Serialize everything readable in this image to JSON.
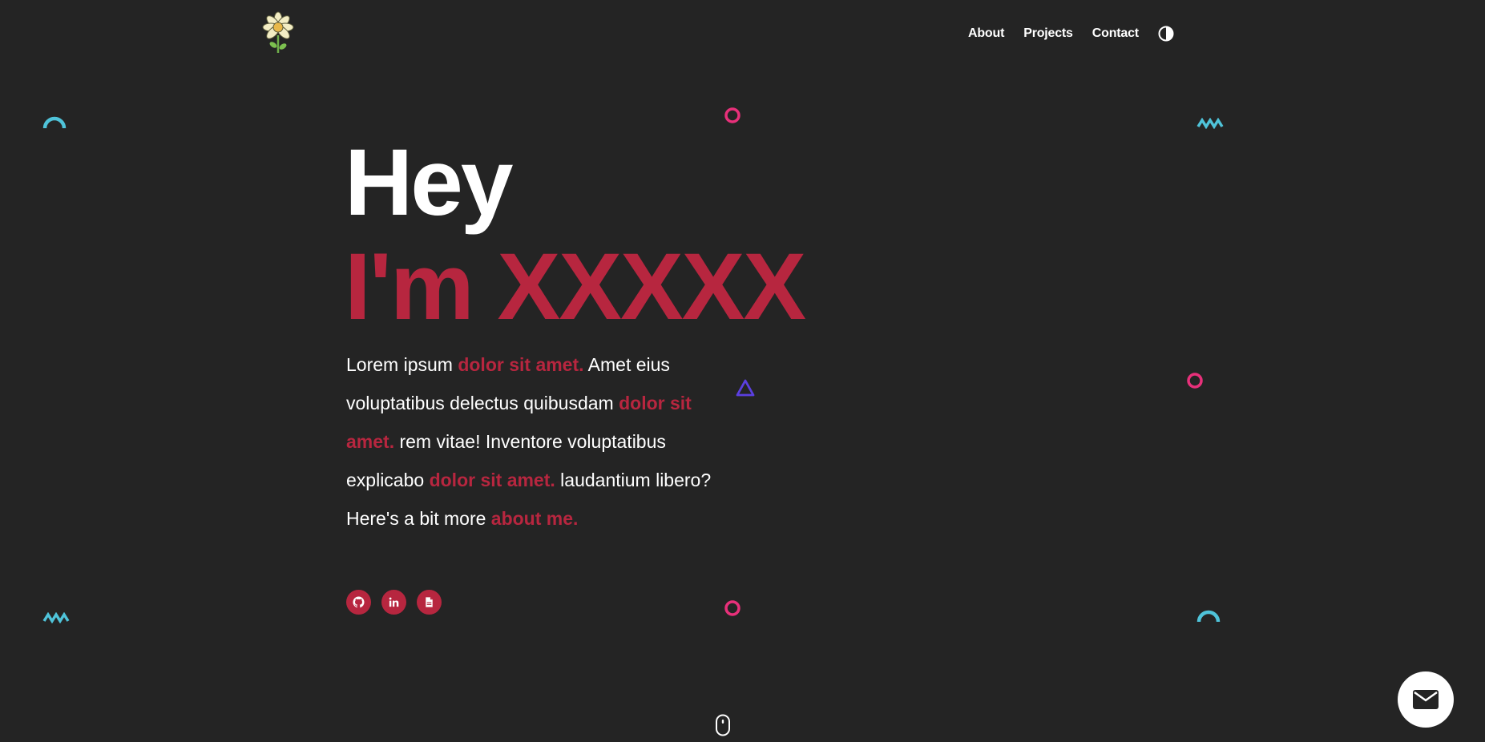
{
  "nav": {
    "items": [
      {
        "label": "About"
      },
      {
        "label": "Projects"
      },
      {
        "label": "Contact"
      }
    ]
  },
  "hero": {
    "greeting": "Hey",
    "name": "I'm XXXXX",
    "description": {
      "p1": "Lorem ipsum ",
      "h1": "dolor sit amet.",
      "p2": " Amet eius voluptatibus delectus quibusdam ",
      "h2": "dolor sit amet.",
      "p3": " rem vitae! Inventore voluptatibus explicabo ",
      "h3": "dolor sit amet.",
      "p4": " laudantium libero? Here's a bit more ",
      "h4": "about me."
    }
  },
  "socials": [
    {
      "icon": "github-icon"
    },
    {
      "icon": "linkedin-icon"
    },
    {
      "icon": "resume-file-icon"
    }
  ],
  "colors": {
    "background": "#242424",
    "accent": "#b7263f",
    "text": "#ffffff",
    "deco_cyan": "#4fc3d9",
    "deco_pink": "#e8307a",
    "deco_purple": "#5b3fe0"
  }
}
